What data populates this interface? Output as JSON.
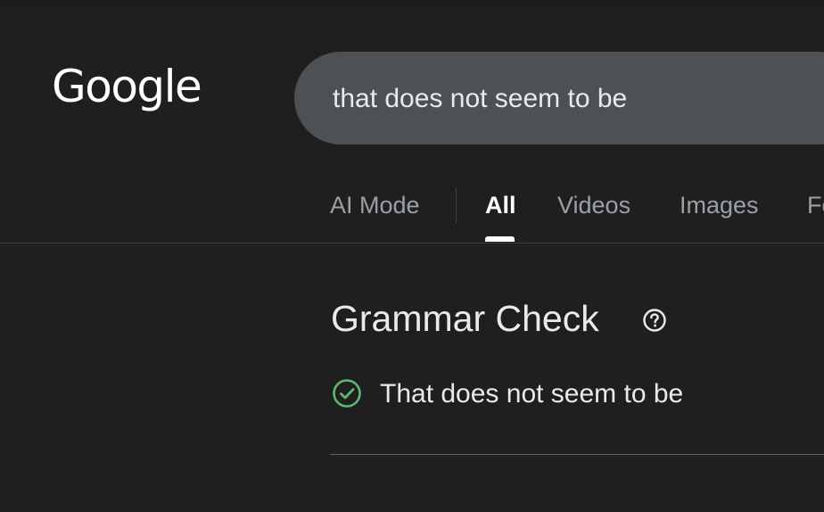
{
  "header": {
    "logo_text": "Google",
    "search_query": "that does not seem to be"
  },
  "tabs": [
    {
      "label": "AI Mode",
      "active": false
    },
    {
      "label": "All",
      "active": true
    },
    {
      "label": "Videos",
      "active": false
    },
    {
      "label": "Images",
      "active": false
    },
    {
      "label": "Fo",
      "active": false
    }
  ],
  "grammar_card": {
    "title": "Grammar Check",
    "help_icon": "help-circle-icon",
    "result_icon": "check-circle-icon",
    "result_icon_color": "#5bb974",
    "result_text": "That does not seem to be"
  },
  "colors": {
    "background": "#1f1f1f",
    "search_box": "#4d5156",
    "tab_inactive": "#9aa0a6",
    "tab_active": "#ffffff"
  }
}
